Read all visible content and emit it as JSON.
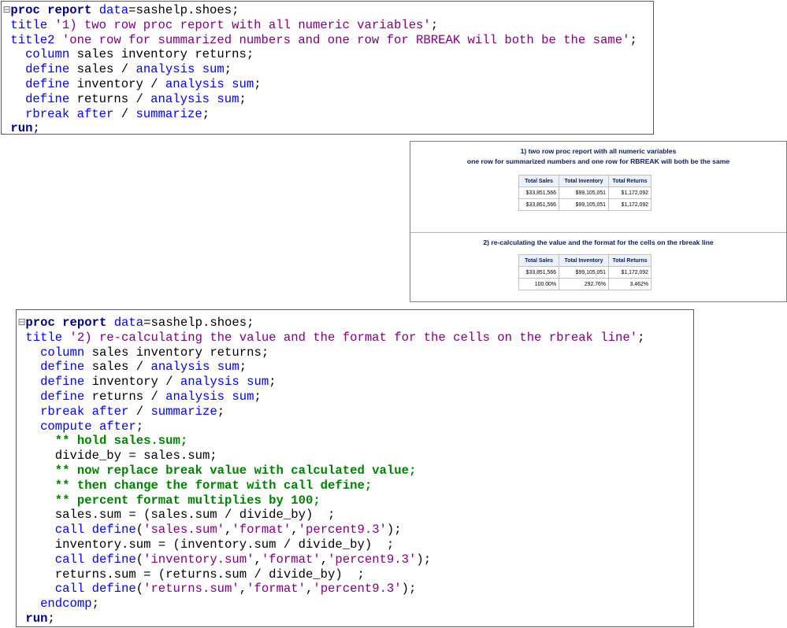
{
  "code1": {
    "lines": [
      [
        [
          "bx",
          "⊟"
        ],
        [
          "kw",
          "proc report "
        ],
        [
          "key",
          "data"
        ],
        [
          "tx",
          "=sashelp.shoes;"
        ]
      ],
      [
        [
          "tx",
          " "
        ],
        [
          "key",
          "title "
        ],
        [
          "str",
          "'1) two row proc report with all numeric variables'"
        ],
        [
          "tx",
          ";"
        ]
      ],
      [
        [
          "tx",
          " "
        ],
        [
          "key",
          "title2 "
        ],
        [
          "str",
          "'one row for summarized numbers and one row for RBREAK will both be the same'"
        ],
        [
          "tx",
          ";"
        ]
      ],
      [
        [
          "tx",
          "   "
        ],
        [
          "key",
          "column "
        ],
        [
          "tx",
          "sales inventory returns;"
        ]
      ],
      [
        [
          "tx",
          "   "
        ],
        [
          "key",
          "define "
        ],
        [
          "tx",
          "sales / "
        ],
        [
          "key",
          "analysis sum"
        ],
        [
          "tx",
          ";"
        ]
      ],
      [
        [
          "tx",
          "   "
        ],
        [
          "key",
          "define "
        ],
        [
          "tx",
          "inventory / "
        ],
        [
          "key",
          "analysis sum"
        ],
        [
          "tx",
          ";"
        ]
      ],
      [
        [
          "tx",
          "   "
        ],
        [
          "key",
          "define "
        ],
        [
          "tx",
          "returns / "
        ],
        [
          "key",
          "analysis sum"
        ],
        [
          "tx",
          ";"
        ]
      ],
      [
        [
          "tx",
          "   "
        ],
        [
          "key",
          "rbreak after "
        ],
        [
          "tx",
          "/ "
        ],
        [
          "key",
          "summarize"
        ],
        [
          "tx",
          ";"
        ]
      ],
      [
        [
          "tx",
          " "
        ],
        [
          "kw",
          "run"
        ],
        [
          "tx",
          ";"
        ]
      ]
    ]
  },
  "code2": {
    "lines": [
      [
        [
          "bx",
          "⊟"
        ],
        [
          "kw",
          "proc report "
        ],
        [
          "key",
          "data"
        ],
        [
          "tx",
          "=sashelp.shoes;"
        ]
      ],
      [
        [
          "tx",
          " "
        ],
        [
          "key",
          "title "
        ],
        [
          "str",
          "'2) re-calculating the value and the format for the cells on the rbreak line'"
        ],
        [
          "tx",
          ";"
        ]
      ],
      [
        [
          "tx",
          "   "
        ],
        [
          "key",
          "column "
        ],
        [
          "tx",
          "sales inventory returns;"
        ]
      ],
      [
        [
          "tx",
          "   "
        ],
        [
          "key",
          "define "
        ],
        [
          "tx",
          "sales / "
        ],
        [
          "key",
          "analysis sum"
        ],
        [
          "tx",
          ";"
        ]
      ],
      [
        [
          "tx",
          "   "
        ],
        [
          "key",
          "define "
        ],
        [
          "tx",
          "inventory / "
        ],
        [
          "key",
          "analysis sum"
        ],
        [
          "tx",
          ";"
        ]
      ],
      [
        [
          "tx",
          "   "
        ],
        [
          "key",
          "define "
        ],
        [
          "tx",
          "returns / "
        ],
        [
          "key",
          "analysis sum"
        ],
        [
          "tx",
          ";"
        ]
      ],
      [
        [
          "tx",
          "   "
        ],
        [
          "key",
          "rbreak after "
        ],
        [
          "tx",
          "/ "
        ],
        [
          "key",
          "summarize"
        ],
        [
          "tx",
          ";"
        ]
      ],
      [
        [
          "tx",
          "   "
        ],
        [
          "key",
          "compute after"
        ],
        [
          "tx",
          ";"
        ]
      ],
      [
        [
          "tx",
          "     "
        ],
        [
          "cm",
          "** hold sales.sum;"
        ]
      ],
      [
        [
          "tx",
          "     divide_by = sales.sum;"
        ]
      ],
      [
        [
          "tx",
          "     "
        ],
        [
          "cm",
          "** now replace break value with calculated value;"
        ]
      ],
      [
        [
          "tx",
          "     "
        ],
        [
          "cm",
          "** then change the format with call define;"
        ]
      ],
      [
        [
          "tx",
          "     "
        ],
        [
          "cm",
          "** percent format multiplies by 100;"
        ]
      ],
      [
        [
          "tx",
          "     sales.sum = (sales.sum / divide_by)  ;"
        ]
      ],
      [
        [
          "tx",
          "     "
        ],
        [
          "key",
          "call define"
        ],
        [
          "tx",
          "("
        ],
        [
          "str",
          "'sales.sum'"
        ],
        [
          "tx",
          ","
        ],
        [
          "str",
          "'format'"
        ],
        [
          "tx",
          ","
        ],
        [
          "str",
          "'percent9.3'"
        ],
        [
          "tx",
          ");"
        ]
      ],
      [
        [
          "tx",
          "     inventory.sum = (inventory.sum / divide_by)  ;"
        ]
      ],
      [
        [
          "tx",
          "     "
        ],
        [
          "key",
          "call define"
        ],
        [
          "tx",
          "("
        ],
        [
          "str",
          "'inventory.sum'"
        ],
        [
          "tx",
          ","
        ],
        [
          "str",
          "'format'"
        ],
        [
          "tx",
          ","
        ],
        [
          "str",
          "'percent9.3'"
        ],
        [
          "tx",
          ");"
        ]
      ],
      [
        [
          "tx",
          "     returns.sum = (returns.sum / divide_by)  ;"
        ]
      ],
      [
        [
          "tx",
          "     "
        ],
        [
          "key",
          "call define"
        ],
        [
          "tx",
          "("
        ],
        [
          "str",
          "'returns.sum'"
        ],
        [
          "tx",
          ","
        ],
        [
          "str",
          "'format'"
        ],
        [
          "tx",
          ","
        ],
        [
          "str",
          "'percent9.3'"
        ],
        [
          "tx",
          ");"
        ]
      ],
      [
        [
          "tx",
          "   "
        ],
        [
          "key",
          "endcomp"
        ],
        [
          "tx",
          ";"
        ]
      ],
      [
        [
          "tx",
          " "
        ],
        [
          "kw",
          "run"
        ],
        [
          "tx",
          ";"
        ]
      ]
    ]
  },
  "output": {
    "section1": {
      "title1": "1) two row proc report with all numeric variables",
      "title2": "one row for summarized numbers and one row for RBREAK will both be the same",
      "headers": [
        "Total Sales",
        "Total Inventory",
        "Total Returns"
      ],
      "rows": [
        [
          "$33,851,566",
          "$99,105,051",
          "$1,172,092"
        ],
        [
          "$33,851,566",
          "$99,105,051",
          "$1,172,092"
        ]
      ]
    },
    "section2": {
      "title1": "2) re-calculating the value and the format for the cells on the rbreak line",
      "headers": [
        "Total Sales",
        "Total Inventory",
        "Total Returns"
      ],
      "rows": [
        [
          "$33,851,566",
          "$99,105,051",
          "$1,172,092"
        ],
        [
          "100.00%",
          "292.76%",
          "3.462%"
        ]
      ]
    }
  }
}
